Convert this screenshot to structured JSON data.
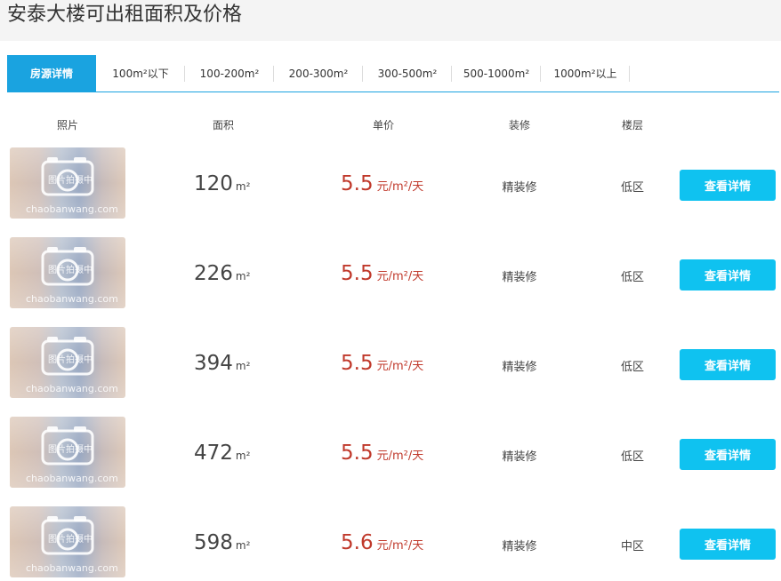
{
  "page_title": "安泰大楼可出租面积及价格",
  "tabs": [
    {
      "label": "房源详情",
      "active": true
    },
    {
      "label": "100m²以下"
    },
    {
      "label": "100-200m²"
    },
    {
      "label": "200-300m²"
    },
    {
      "label": "300-500m²"
    },
    {
      "label": "500-1000m²"
    },
    {
      "label": "1000m²以上"
    }
  ],
  "columns": {
    "photo": "照片",
    "area": "面积",
    "price": "单价",
    "decoration": "装修",
    "floor": "楼层"
  },
  "listings": [
    {
      "area": "120",
      "area_unit": "m²",
      "price": "5.5",
      "price_unit": "元/m²/天",
      "decoration": "精装修",
      "floor": "低区",
      "button": "查看详情",
      "photo_text": "图片拍摄中",
      "watermark": "chaobanwang.com"
    },
    {
      "area": "226",
      "area_unit": "m²",
      "price": "5.5",
      "price_unit": "元/m²/天",
      "decoration": "精装修",
      "floor": "低区",
      "button": "查看详情",
      "photo_text": "图片拍摄中",
      "watermark": "chaobanwang.com"
    },
    {
      "area": "394",
      "area_unit": "m²",
      "price": "5.5",
      "price_unit": "元/m²/天",
      "decoration": "精装修",
      "floor": "低区",
      "button": "查看详情",
      "photo_text": "图片拍摄中",
      "watermark": "chaobanwang.com"
    },
    {
      "area": "472",
      "area_unit": "m²",
      "price": "5.5",
      "price_unit": "元/m²/天",
      "decoration": "精装修",
      "floor": "低区",
      "button": "查看详情",
      "photo_text": "图片拍摄中",
      "watermark": "chaobanwang.com"
    },
    {
      "area": "598",
      "area_unit": "m²",
      "price": "5.6",
      "price_unit": "元/m²/天",
      "decoration": "精装修",
      "floor": "中区",
      "button": "查看详情",
      "photo_text": "图片拍摄中",
      "watermark": "chaobanwang.com"
    }
  ],
  "colors": {
    "accent": "#1aa3e0",
    "button": "#0fc2f0",
    "price": "#c0392b",
    "title_bar": "#f4f4f4"
  },
  "icons": {
    "photo_placeholder": "camera-icon"
  }
}
